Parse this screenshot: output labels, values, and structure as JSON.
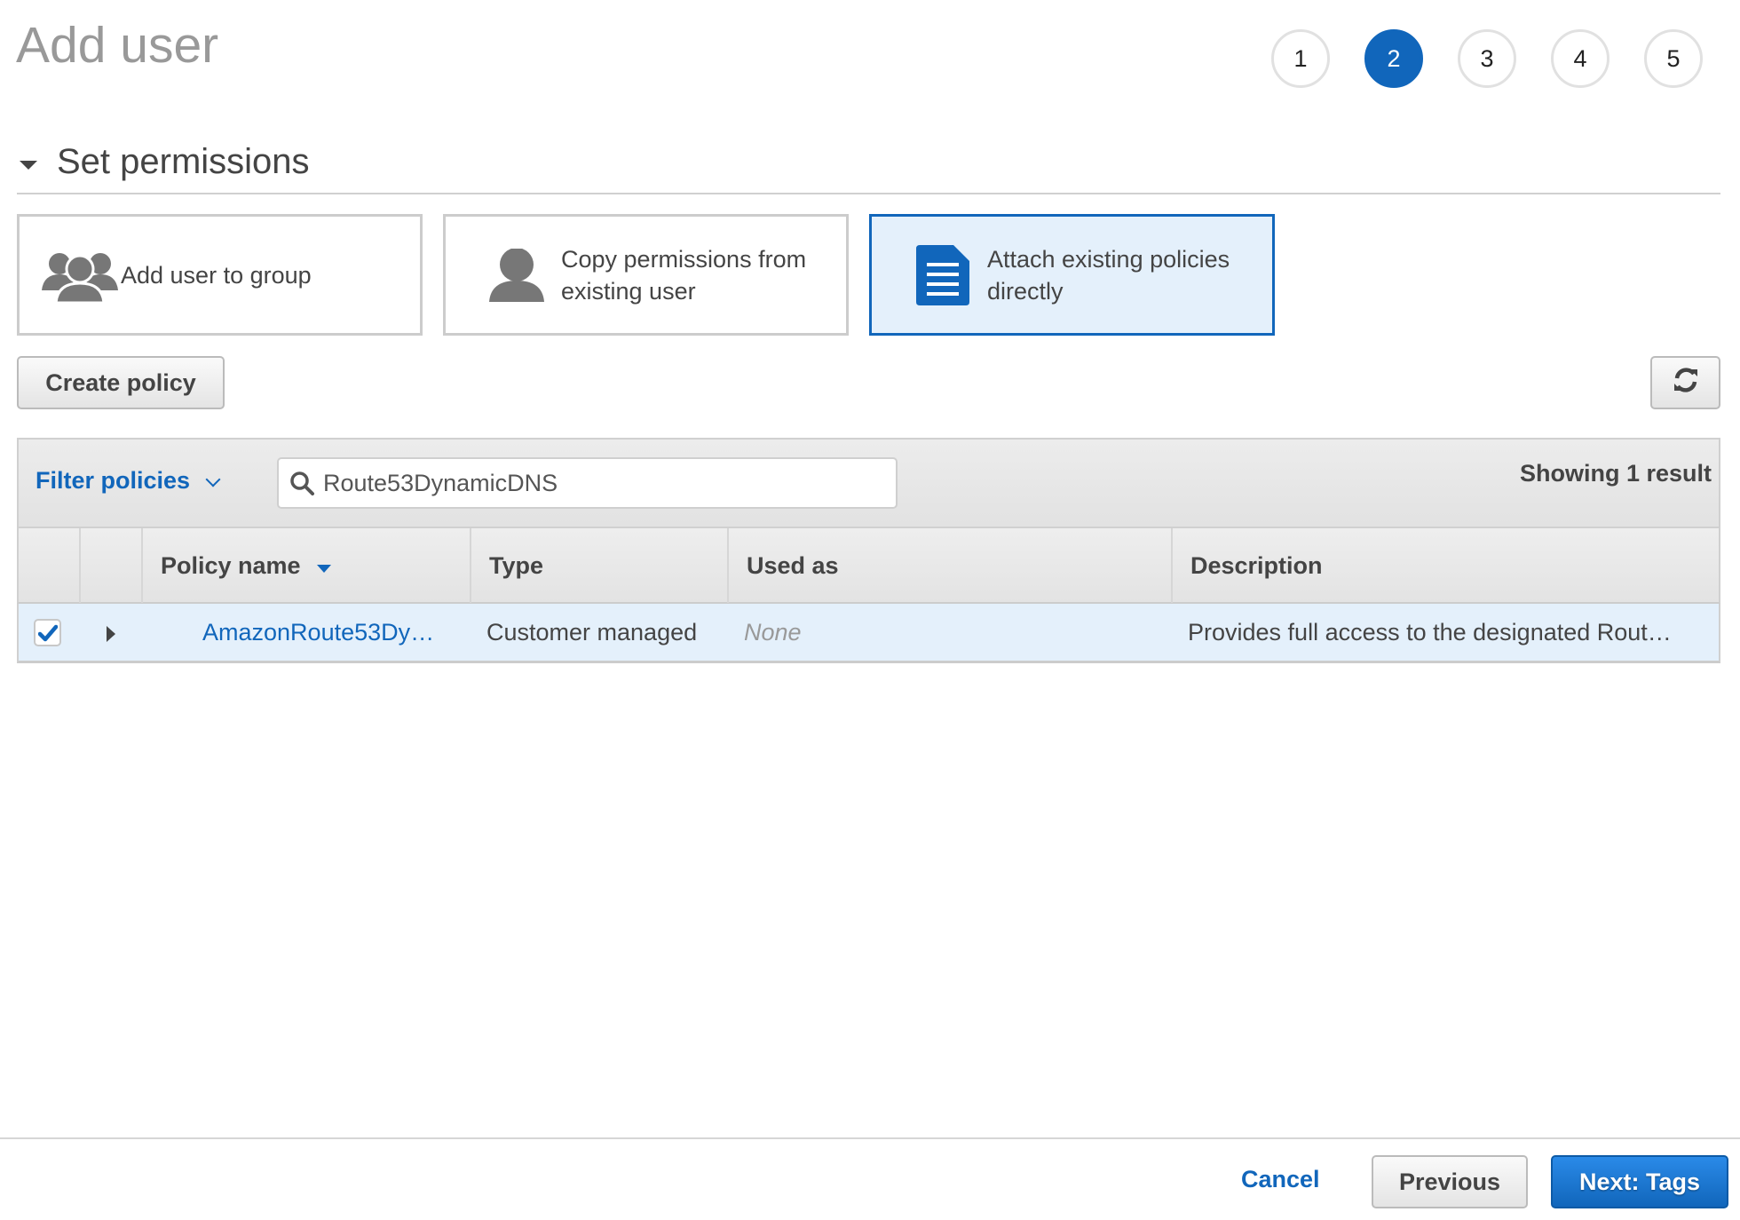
{
  "page": {
    "title": "Add user"
  },
  "steps": {
    "items": [
      "1",
      "2",
      "3",
      "4",
      "5"
    ],
    "current": 2
  },
  "section": {
    "title": "Set permissions",
    "options": [
      {
        "label": "Add user to group",
        "icon": "users-group-icon",
        "selected": false
      },
      {
        "label": "Copy permissions from existing user",
        "icon": "user-icon",
        "selected": false
      },
      {
        "label": "Attach existing policies directly",
        "icon": "document-icon",
        "selected": true
      }
    ]
  },
  "toolbar": {
    "create_policy_label": "Create policy",
    "refresh_icon": "refresh-icon"
  },
  "filter": {
    "label": "Filter policies",
    "search_value": "Route53DynamicDNS",
    "search_icon": "search-icon",
    "result_count_text": "Showing 1 result"
  },
  "table": {
    "columns": [
      "",
      "",
      "Policy name",
      "Type",
      "Used as",
      "Description"
    ],
    "sort_column": "Policy name",
    "rows": [
      {
        "checked": true,
        "policy_name": "AmazonRoute53Dy…",
        "type": "Customer managed",
        "used_as": "None",
        "description": "Provides full access to the designated Rout…"
      }
    ]
  },
  "footer": {
    "cancel_label": "Cancel",
    "previous_label": "Previous",
    "next_label": "Next: Tags"
  },
  "colors": {
    "accent": "#1166bb",
    "selected_bg": "#e4f0fb",
    "muted_text": "#999999"
  }
}
